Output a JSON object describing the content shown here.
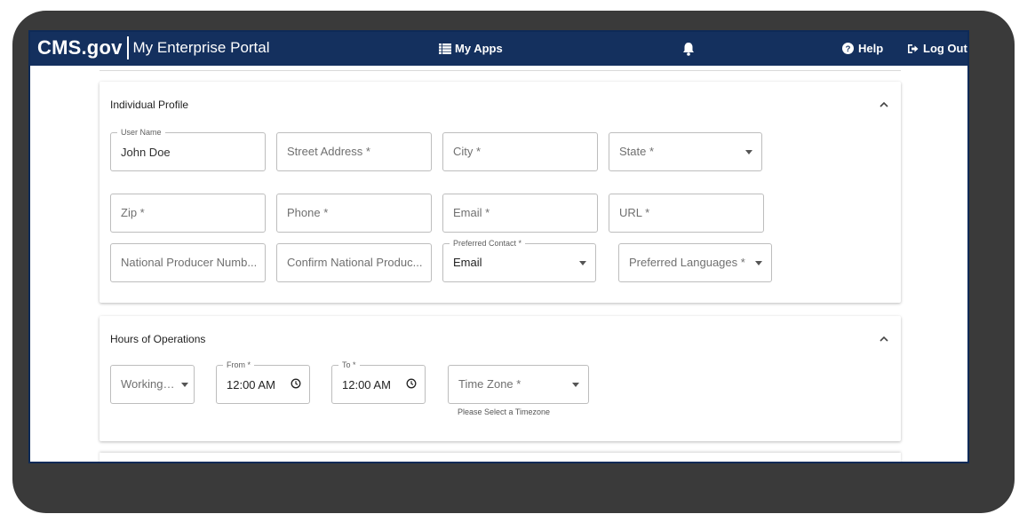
{
  "header": {
    "brand_cms": "CMS.gov",
    "brand_portal": "My Enterprise Portal",
    "my_apps_label": "My Apps",
    "help_label": "Help",
    "logout_label": "Log Out",
    "icons": [
      "grid-list-icon",
      "bell-icon",
      "help-circle-icon",
      "logout-icon"
    ]
  },
  "individual_profile": {
    "title": "Individual Profile",
    "user_name": {
      "label": "User Name",
      "value": "John Doe"
    },
    "street_address": {
      "placeholder": "Street Address *"
    },
    "city": {
      "placeholder": "City *"
    },
    "state": {
      "placeholder": "State *"
    },
    "zip": {
      "placeholder": "Zip *"
    },
    "phone": {
      "placeholder": "Phone *"
    },
    "email": {
      "placeholder": "Email *"
    },
    "url": {
      "placeholder": "URL *"
    },
    "npn": {
      "placeholder": "National Producer Numb..."
    },
    "confirm_npn": {
      "placeholder": "Confirm National Produc..."
    },
    "preferred_contact": {
      "label": "Preferred Contact *",
      "value": "Email"
    },
    "preferred_languages": {
      "placeholder": "Preferred Languages *"
    }
  },
  "hours_of_operations": {
    "title": "Hours of Operations",
    "working_days": {
      "placeholder": "Working D..."
    },
    "from": {
      "label": "From *",
      "value": "12:00 AM"
    },
    "to": {
      "label": "To *",
      "value": "12:00 AM"
    },
    "time_zone": {
      "placeholder": "Time Zone *",
      "helper": "Please Select a Timezone"
    }
  },
  "colors": {
    "header_bg": "#14305e",
    "window_border": "#0e2a57",
    "backdrop": "#3a3a3a"
  }
}
